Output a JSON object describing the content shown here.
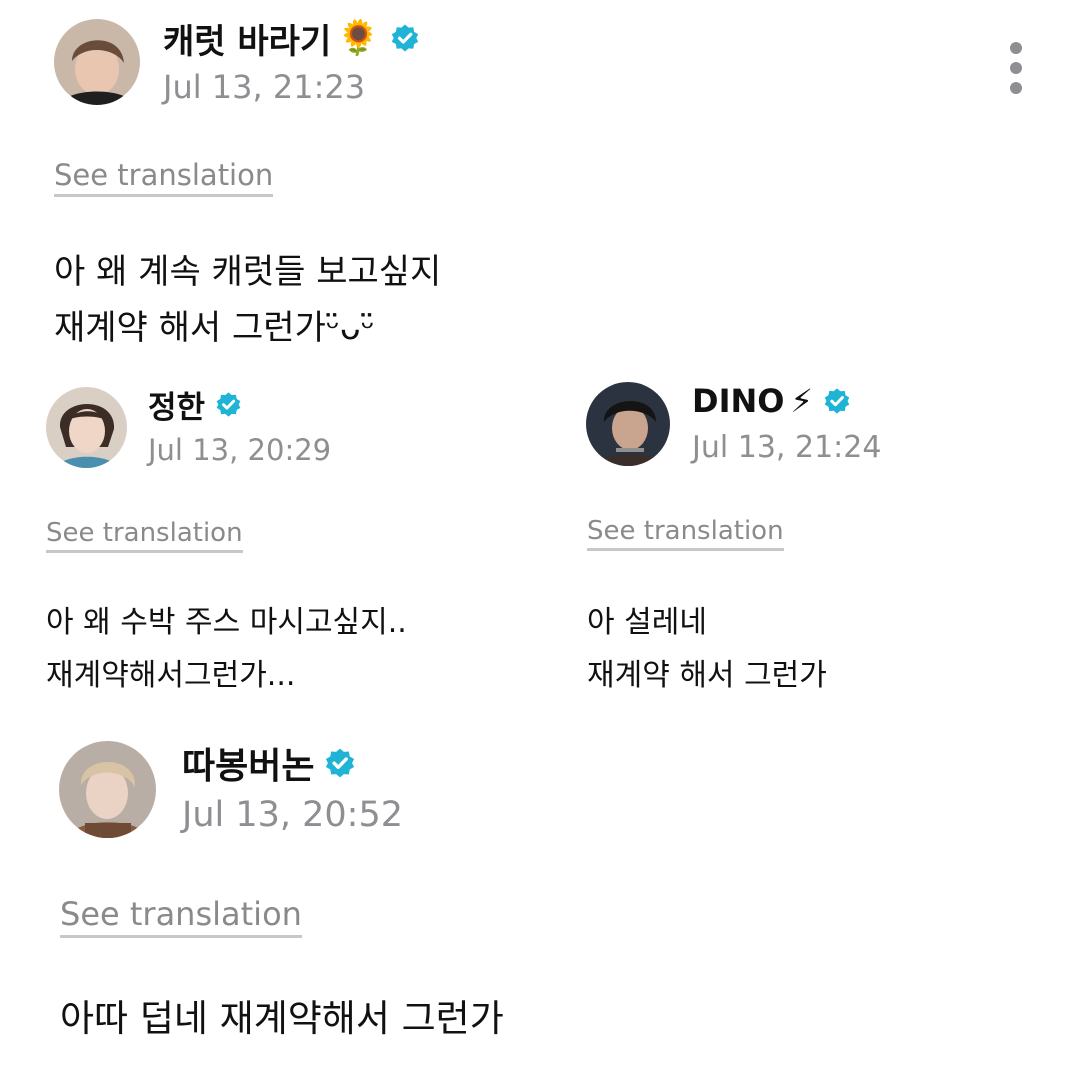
{
  "colors": {
    "verified_badge": "#1fb4d6",
    "timestamp": "#8e8e93",
    "link": "#8a8a8a",
    "text": "#111111"
  },
  "posts": [
    {
      "author": "캐럿 바라기",
      "emoji": "🌻",
      "emoji_icon": "sunflower-icon",
      "verified": true,
      "timestamp": "Jul 13, 21:23",
      "see_translation": "See translation",
      "text": "아 왜 계속 캐럿들 보고싶지\n재계약 해서 그런가ᵕ̈ᴗᵕ̈"
    },
    {
      "author": "정한",
      "verified": true,
      "timestamp": "Jul 13, 20:29",
      "see_translation": "See translation",
      "text": "아 왜 수박 주스 마시고싶지..\n재계약해서그런가..."
    },
    {
      "author": "DINO",
      "emoji": "⚡",
      "emoji_icon": "lightning-icon",
      "verified": true,
      "timestamp": "Jul 13, 21:24",
      "see_translation": "See translation",
      "text": "아 설레네\n재계약 해서 그런가"
    },
    {
      "author": "따봉버논",
      "verified": true,
      "timestamp": "Jul 13, 20:52",
      "see_translation": "See translation",
      "text": "아따 덥네 재계약해서 그런가"
    }
  ],
  "more_icon": "more-vertical-icon"
}
